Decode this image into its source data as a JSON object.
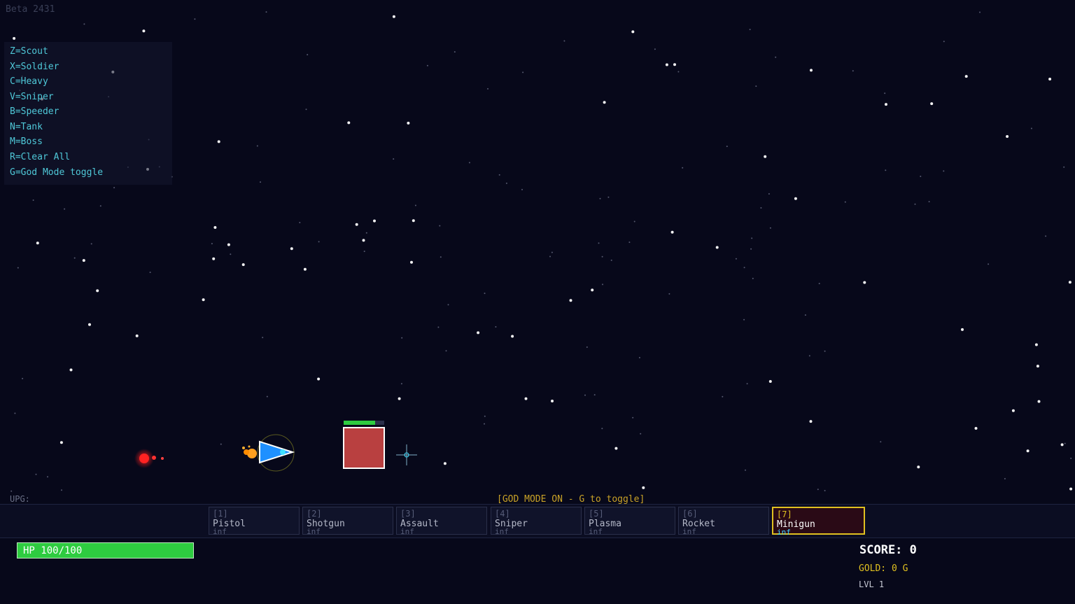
{
  "version": "Beta 2431",
  "help": [
    "Z=Scout",
    "X=Soldier",
    "C=Heavy",
    "V=Sniper",
    "B=Speeder",
    "N=Tank",
    "M=Boss",
    "R=Clear All",
    "G=God Mode toggle"
  ],
  "status": {
    "god_mode_message": "[GOD MODE ON - G to toggle]",
    "upg_label": "UPG:"
  },
  "weapons": [
    {
      "key": "[1]",
      "name": "Pistol",
      "ammo": "inf",
      "active": false
    },
    {
      "key": "[2]",
      "name": "Shotgun",
      "ammo": "inf",
      "active": false
    },
    {
      "key": "[3]",
      "name": "Assault",
      "ammo": "inf",
      "active": false
    },
    {
      "key": "[4]",
      "name": "Sniper",
      "ammo": "inf",
      "active": false
    },
    {
      "key": "[5]",
      "name": "Plasma",
      "ammo": "inf",
      "active": false
    },
    {
      "key": "[6]",
      "name": "Rocket",
      "ammo": "inf",
      "active": false
    },
    {
      "key": "[7]",
      "name": "Minigun",
      "ammo": "inf",
      "active": true
    }
  ],
  "hud": {
    "hp_text": "HP  100/100",
    "hp_fraction": 1.0,
    "score_text": "SCORE:  0",
    "gold_text": "GOLD:  0 G",
    "level_text": "LVL 1"
  },
  "enemy": {
    "health_fraction": 0.78
  },
  "colors": {
    "background": "#07081a",
    "player": "#1e90ff",
    "enemy": "#b94040",
    "hp_green": "#2ecc40",
    "gold": "#e0c020",
    "cyan_text": "#4fc8d8"
  }
}
